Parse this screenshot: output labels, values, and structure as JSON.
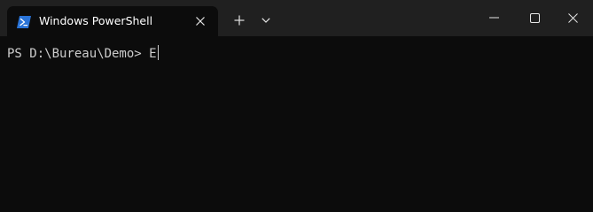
{
  "window": {
    "tab": {
      "title": "Windows PowerShell",
      "icon": "powershell-icon",
      "close_icon": "close-icon"
    },
    "new_tab_icon": "plus-icon",
    "dropdown_icon": "chevron-down-icon",
    "controls": {
      "minimize_icon": "minimize-icon",
      "maximize_icon": "maximize-icon",
      "close_icon": "close-icon"
    }
  },
  "terminal": {
    "prompt": "PS D:\\Bureau\\Demo> ",
    "input": "E"
  },
  "colors": {
    "titlebar": "#202020",
    "terminal_bg": "#0c0c0c",
    "text": "#cccccc",
    "powershell_icon": "#2a74d8"
  }
}
